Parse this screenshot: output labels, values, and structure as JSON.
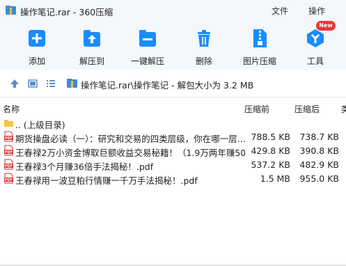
{
  "window": {
    "title": "操作笔记.rar - 360压缩",
    "menu_file": "文件",
    "menu_operation": "操作"
  },
  "toolbar": {
    "items": [
      {
        "label": "添加",
        "icon": "add-icon"
      },
      {
        "label": "解压到",
        "icon": "extract-to-icon"
      },
      {
        "label": "一键解压",
        "icon": "one-click-extract-icon"
      },
      {
        "label": "删除",
        "icon": "trash-icon"
      },
      {
        "label": "图片压缩",
        "icon": "image-compress-icon"
      },
      {
        "label": "工具",
        "icon": "tools-icon"
      }
    ],
    "new_badge": "New"
  },
  "pathbar": {
    "path": "操作笔记.rar\\操作笔记 - 解包大小为 3.2 MB"
  },
  "columns": {
    "name": "名称",
    "packed": "压缩前",
    "original": "压缩后",
    "type": "类"
  },
  "files": [
    {
      "name": ".. (上级目录)",
      "packed": "",
      "original": "",
      "type": "folder"
    },
    {
      "name": "期货操盘必读（一）：研究和交易的四类层级，你在哪一层...",
      "packed": "788.5 KB",
      "original": "738.7 KB",
      "type": "pdf"
    },
    {
      "name": "王春禄2万小资金博取巨额收益交易秘籍！（1.9万两年赚50...",
      "packed": "429.8 KB",
      "original": "390.8 KB",
      "type": "pdf"
    },
    {
      "name": "王春禄3个月赚36倍手法揭秘！.pdf",
      "packed": "537.2 KB",
      "original": "482.9 KB",
      "type": "pdf"
    },
    {
      "name": "王春禄用一波豆粕行情赚一千万手法揭秘！.pdf",
      "packed": "1.5 MB",
      "original": "955.0 KB",
      "type": "pdf"
    }
  ],
  "colors": {
    "accent": "#1a8cff",
    "pdf_red": "#d32f2f",
    "folder_yellow": "#f5c542",
    "badge_red": "#e53935"
  }
}
